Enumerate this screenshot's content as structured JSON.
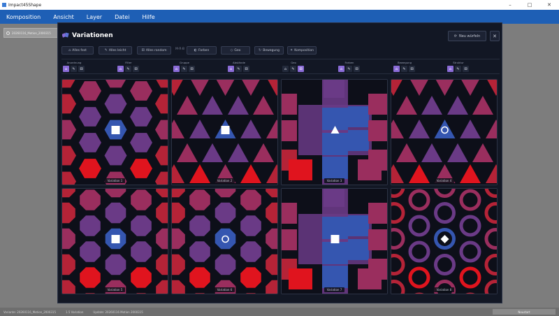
{
  "window": {
    "title": "Impact45Shape",
    "controls": [
      "–",
      "□",
      "✕"
    ]
  },
  "menu": [
    "Komposition",
    "Ansicht",
    "Layer",
    "Datei",
    "Hilfe"
  ],
  "background": {
    "chip_label": "20260116_Motion_2000315"
  },
  "status": {
    "left": "Variante: 20260116_Motion_2000315",
    "middle": "1.5 Variation",
    "right_text": "Update: 20260116 Motion 2000315",
    "button": "Neustart"
  },
  "dialog": {
    "title": "Variationen",
    "regen_label": "Neu würfeln",
    "close_label": "✕",
    "toolbar": {
      "all_fixed": "Alles fest",
      "all_light": "Alles leicht",
      "all_random": "Alles random",
      "sep": "M·R·B",
      "farben": "Farben",
      "geo": "Geo",
      "bewegung": "Bewegung",
      "komposition": "Komposition"
    },
    "attributes": [
      {
        "label": "Anordnung",
        "selected": 0
      },
      {
        "label": "Filter",
        "selected": 0
      },
      {
        "label": "Gruppe",
        "selected": 0
      },
      {
        "label": "Abstände",
        "selected": 0
      },
      {
        "label": "Geo",
        "selected": 2
      },
      {
        "label": "Farben",
        "selected": 0
      },
      {
        "label": "Bewegung",
        "selected": 0
      },
      {
        "label": "Struktur",
        "selected": 0
      }
    ],
    "variations": [
      {
        "label": "Variation 1",
        "pattern": "hexagons",
        "center": "square"
      },
      {
        "label": "Variation 2",
        "pattern": "triangles",
        "center": "square"
      },
      {
        "label": "Variation 3",
        "pattern": "rects",
        "center": "triangle"
      },
      {
        "label": "Variation 4",
        "pattern": "triangles",
        "center": "circle"
      },
      {
        "label": "Variation 5",
        "pattern": "octagons",
        "center": "square"
      },
      {
        "label": "Variation 6",
        "pattern": "octagons",
        "center": "circle"
      },
      {
        "label": "Variation 7",
        "pattern": "rects",
        "center": "square"
      },
      {
        "label": "Variation 8",
        "pattern": "rings",
        "center": "diamond"
      }
    ],
    "colors": {
      "blue": "#3556b0",
      "purple": "#6a3a86",
      "magenta": "#9a2e5e",
      "red": "#b52337",
      "bright_red": "#e0141e"
    }
  }
}
